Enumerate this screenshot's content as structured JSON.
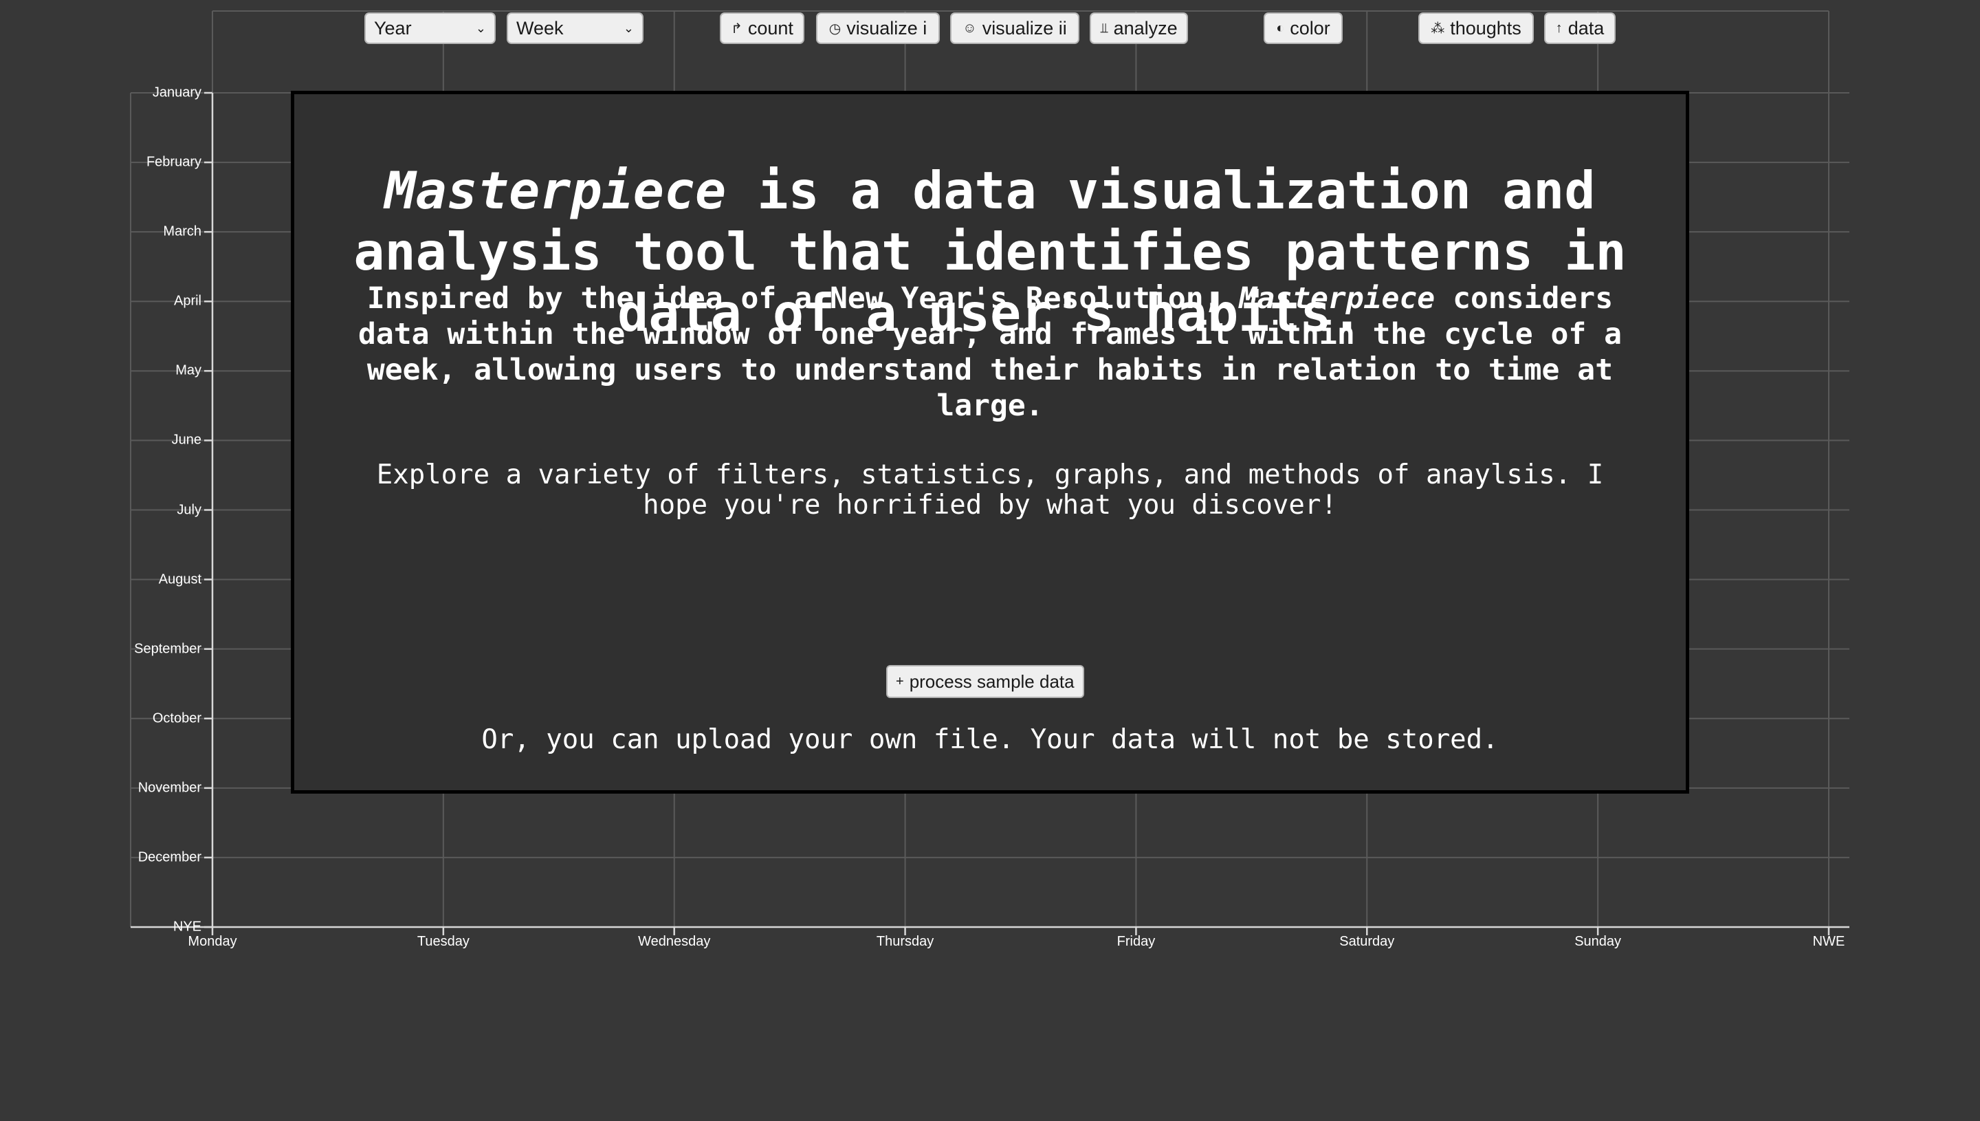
{
  "toolbar": {
    "year_select": "Year",
    "week_select": "Week",
    "count": {
      "icon": "count-icon",
      "glyph": "↱",
      "label": "count"
    },
    "visualize_i": {
      "icon": "clock-icon",
      "glyph": "◷",
      "label": "visualize i"
    },
    "visualize_ii": {
      "icon": "smiley-icon",
      "glyph": "☺",
      "label": "visualize ii"
    },
    "analyze": {
      "icon": "analyze-icon",
      "glyph": "⫫",
      "label": "analyze"
    },
    "color": {
      "icon": "half-circle-icon",
      "glyph": "◐",
      "label": "color"
    },
    "thoughts": {
      "icon": "thoughts-icon",
      "glyph": "⁂",
      "label": "thoughts"
    },
    "data": {
      "icon": "upload-arrow-icon",
      "glyph": "↑",
      "label": "data"
    }
  },
  "chart_data": {
    "type": "scatter",
    "y_tick_labels": [
      "January",
      "February",
      "March",
      "April",
      "May",
      "June",
      "July",
      "August",
      "September",
      "October",
      "November",
      "December",
      "NYE"
    ],
    "x_tick_labels": [
      "Monday",
      "Tuesday",
      "Wednesday",
      "Thursday",
      "Friday",
      "Saturday",
      "Sunday",
      "NWE"
    ],
    "grid": true,
    "series": []
  },
  "modal": {
    "title_emph": "Masterpiece",
    "title_rest": " is a data visualization and analysis tool that identifies patterns in data of a user's habits.",
    "p1_start": "Inspired by the idea of a New Year's Resolution, ",
    "p1_emph": "Masterpiece",
    "p1_rest": " considers data within the window of one year, and frames it within the cycle of a week, allowing users to understand their habits in relation to time at large.",
    "p2": "Explore a variety of filters, statistics, graphs, and methods of anaylsis. I hope you're horrified by what you discover!",
    "sample_button": {
      "icon": "plus-icon",
      "glyph": "+",
      "label": "process sample data"
    },
    "p3": "Or, you can upload your own file. Your data will not be stored."
  },
  "colors": {
    "background": "#373737",
    "modal_background": "#303030",
    "modal_border": "#000000",
    "grid": "#5a5a5a",
    "axis": "#d8d8d8",
    "text": "#ffffff",
    "button_bg": "#efefef"
  }
}
